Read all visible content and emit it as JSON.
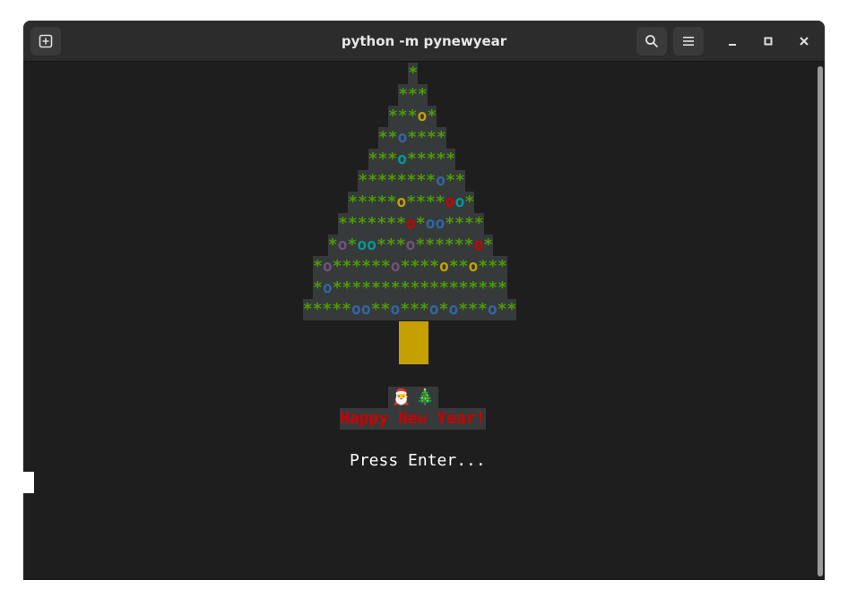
{
  "window": {
    "title": "python -m pynewyear",
    "buttons": [
      "new-tab-icon",
      "search-icon",
      "menu-icon",
      "minimize-icon",
      "maximize-icon",
      "close-icon"
    ]
  },
  "colors": {
    "star": "#4e9a06",
    "orange": "#c4a000",
    "blue": "#3465a4",
    "teal": "#06989a",
    "red": "#cc0000",
    "purple": "#75507b",
    "trunk": "#c4a000",
    "greeting": "#cc0000"
  },
  "tree": {
    "rows": [
      "*",
      "***",
      "***o*",
      "**o****",
      "***o*****",
      "********o**",
      "*****o****oo*",
      "*******o*oo****",
      "*o*oo***o******o*",
      "*o******o****o**o***",
      "*o******************",
      "*****oo**o***o*o***o**"
    ],
    "ornaments": [
      [],
      [],
      [
        {
          "i": 3,
          "c": "orange"
        }
      ],
      [
        {
          "i": 2,
          "c": "blue"
        }
      ],
      [
        {
          "i": 3,
          "c": "teal"
        }
      ],
      [
        {
          "i": 8,
          "c": "blue"
        }
      ],
      [
        {
          "i": 5,
          "c": "orange"
        },
        {
          "i": 10,
          "c": "red"
        },
        {
          "i": 11,
          "c": "teal"
        }
      ],
      [
        {
          "i": 7,
          "c": "red"
        },
        {
          "i": 9,
          "c": "blue"
        },
        {
          "i": 10,
          "c": "blue"
        }
      ],
      [
        {
          "i": 1,
          "c": "purple"
        },
        {
          "i": 3,
          "c": "teal"
        },
        {
          "i": 4,
          "c": "teal"
        },
        {
          "i": 8,
          "c": "purple"
        },
        {
          "i": 15,
          "c": "red"
        }
      ],
      [
        {
          "i": 1,
          "c": "purple"
        },
        {
          "i": 8,
          "c": "purple"
        },
        {
          "i": 13,
          "c": "orange"
        },
        {
          "i": 16,
          "c": "orange"
        }
      ],
      [
        {
          "i": 1,
          "c": "blue"
        }
      ],
      [
        {
          "i": 6,
          "c": "blue"
        },
        {
          "i": 7,
          "c": "blue"
        },
        {
          "i": 10,
          "c": "teal"
        },
        {
          "i": 14,
          "c": "purple"
        },
        {
          "i": 16,
          "c": "purple"
        },
        {
          "i": 20,
          "c": "blue"
        }
      ]
    ]
  },
  "emoji_line": "🎅 🎄",
  "greeting": "Happy New Year!",
  "prompt": "Press Enter..."
}
